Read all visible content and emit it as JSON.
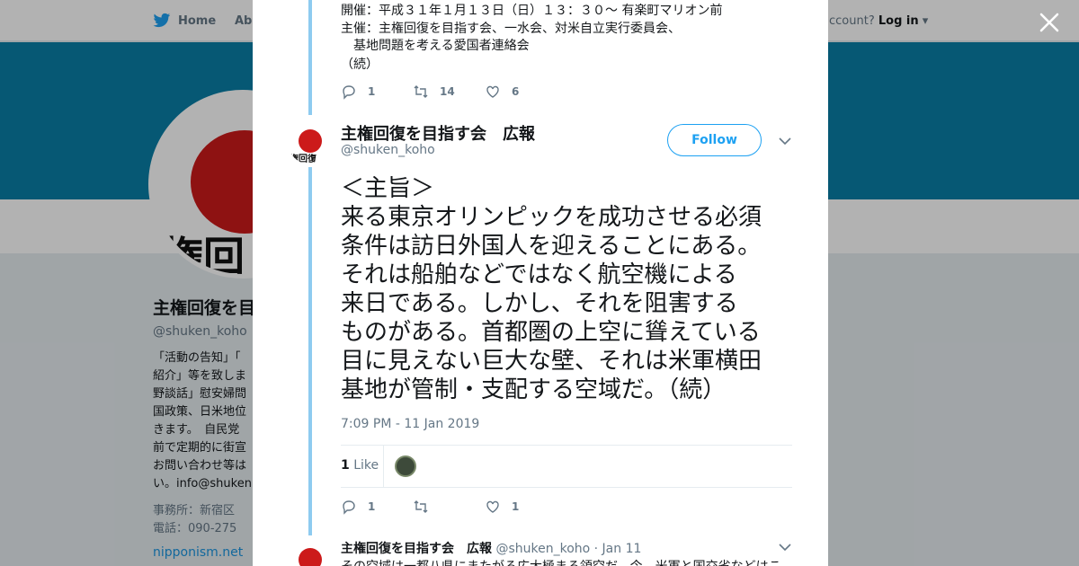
{
  "topnav": {
    "home_label": "Home",
    "about_label": "Abo",
    "account_prompt": "ccount?",
    "login_label": "Log in"
  },
  "profile": {
    "avatar_text": "権回",
    "name": "主権回復を目",
    "handle": "@shuken_koho",
    "bio": "「活動の告知」「\n紹介」等を致しま\n野談話」慰安婦問\n国政策、日米地位\nきます。　自民党\n前で定期的に街宣\nお問い合わせ等は\nい。info@shuken",
    "location": "事務所：新宿区\n電話：090-275",
    "link": "nipponism.net"
  },
  "prev_tweet": {
    "lines": [
      "開催：平成３１年１月１３日（日）１３：３０～ 有楽町マリオン前",
      "主催：主権回復を目指す会、一水会、対米自立実行委員会、",
      "　基地問題を考える愛国者連絡会",
      "（続）"
    ],
    "replies": "1",
    "retweets": "14",
    "likes": "6"
  },
  "main_tweet": {
    "avatar_text": "権回復",
    "name": "主権回復を目指す会　広報",
    "handle": "@shuken_koho",
    "follow_label": "Follow",
    "text": "＜主旨＞\n来る東京オリンピックを成功させる必須\n条件は訪日外国人を迎えることにある。\nそれは船舶などではなく航空機による\n来日である。しかし、それを阻害する\nものがある。首都圏の上空に聳えている\n目に見えない巨大な壁、それは米軍横田\n基地が管制・支配する空域だ。（続）",
    "timestamp": "7:09 PM - 11 Jan 2019",
    "like_count": "1",
    "like_label": "Like",
    "replies": "1",
    "retweets": "",
    "likes": "1"
  },
  "next_tweet": {
    "name": "主権回復を目指す会　広報",
    "handle": "@shuken_koho",
    "date": "· Jan 11",
    "text": "その空域は一都八県にまたがる広大極まる領空だ。今、米軍と国交省などはこ"
  },
  "colors": {
    "accent": "#1da1f2",
    "banner": "#0a7fa6",
    "thread": "#8ecbf0"
  }
}
